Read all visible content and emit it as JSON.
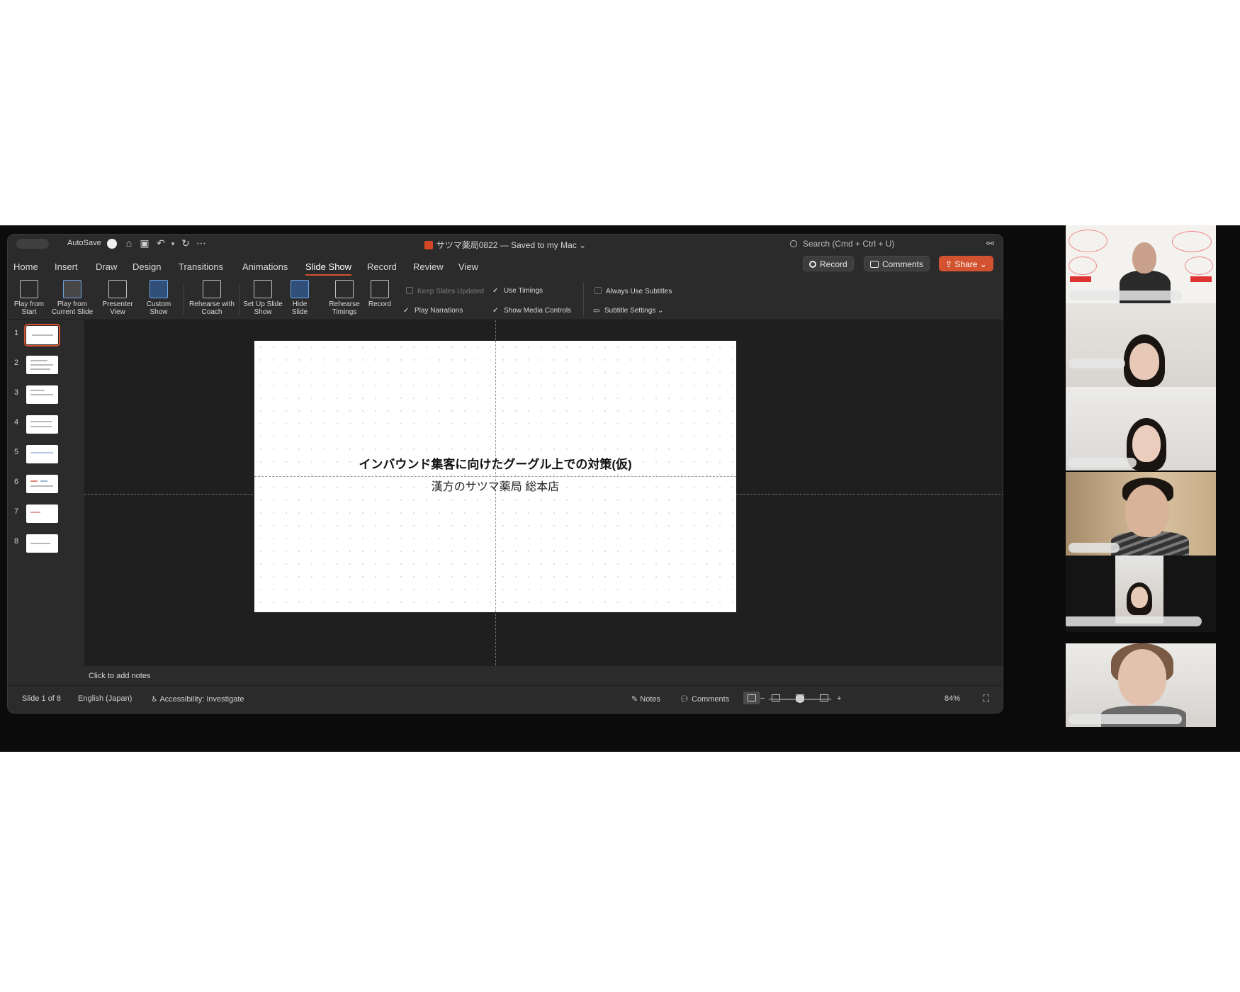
{
  "titlebar": {
    "autosave_label": "AutoSave",
    "document_title": "サツマ薬局0822 — Saved to my Mac",
    "search_placeholder": "Search (Cmd + Ctrl + U)"
  },
  "tabs": [
    "Home",
    "Insert",
    "Draw",
    "Design",
    "Transitions",
    "Animations",
    "Slide Show",
    "Record",
    "Review",
    "View"
  ],
  "active_tab": "Slide Show",
  "top_buttons": {
    "record": "Record",
    "comments": "Comments",
    "share": "Share"
  },
  "ribbon": {
    "play_from_start": "Play from Start",
    "play_from_current": "Play from Current Slide",
    "presenter_view": "Presenter View",
    "custom_show": "Custom Show",
    "rehearse_coach": "Rehearse with Coach",
    "set_up": "Set Up Slide Show",
    "hide_slide": "Hide Slide",
    "rehearse_timings": "Rehearse Timings",
    "record": "Record",
    "keep_updated": "Keep Slides Updated",
    "use_timings": "Use Timings",
    "play_narrations": "Play Narrations",
    "show_media_controls": "Show Media Controls",
    "always_subtitles": "Always Use Subtitles",
    "subtitle_settings": "Subtitle Settings"
  },
  "thumbnails": [
    "1",
    "2",
    "3",
    "4",
    "5",
    "6",
    "7",
    "8"
  ],
  "selected_slide": 1,
  "slide": {
    "title": "インバウンド集客に向けたグーグル上での対策(仮)",
    "subtitle": "漢方のサツマ薬局 総本店"
  },
  "notes_placeholder": "Click to add notes",
  "status": {
    "slide_counter": "Slide 1 of 8",
    "language": "English (Japan)",
    "accessibility": "Accessibility: Investigate",
    "notes": "Notes",
    "comments": "Comments",
    "zoom": "84%"
  },
  "colors": {
    "accent": "#d35230",
    "speaking_border": "#2fd36a"
  },
  "participants": [
    "participant-1",
    "participant-2",
    "participant-3",
    "participant-4",
    "participant-5",
    "participant-6"
  ],
  "speaking_participant": 4
}
